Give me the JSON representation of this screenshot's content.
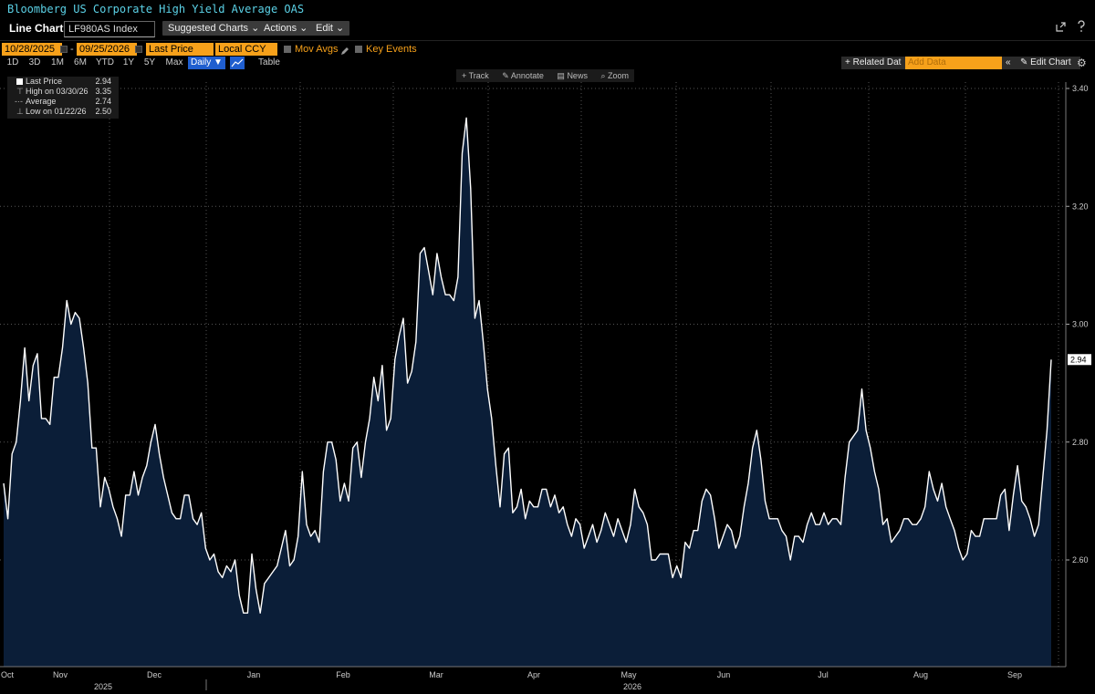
{
  "window": {
    "title": "Bloomberg US Corporate High Yield Average OAS"
  },
  "toolbar": {
    "chart_type": "Line Chart",
    "ticker": "LF980AS Index",
    "suggested_label": "Suggested Charts",
    "actions_label": "Actions",
    "edit_label": "Edit",
    "dropdown_glyph": "⌄"
  },
  "controls": {
    "start_date": "10/28/2025",
    "end_date": "09/25/2026",
    "date_sep": "-",
    "field": "Last Price",
    "currency": "Local CCY",
    "mov_avgs_label": "Mov Avgs",
    "key_events_label": "Key Events"
  },
  "ranges": [
    "1D",
    "3D",
    "1M",
    "6M",
    "YTD",
    "1Y",
    "5Y",
    "Max"
  ],
  "frequency": "Daily ▼",
  "table_label": "Table",
  "related_data_label": "+ Related Dat",
  "add_data_placeholder": "Add Data",
  "collapse_glyph": "«",
  "edit_chart_label": "Edit Chart",
  "chart_tools": [
    "Track",
    "Annotate",
    "News",
    "Zoom"
  ],
  "legend": [
    {
      "name": "Last Price",
      "value": "2.94"
    },
    {
      "name": "High on 03/30/26",
      "value": "3.35"
    },
    {
      "name": "Average",
      "value": "2.74"
    },
    {
      "name": "Low on 01/22/26",
      "value": "2.50"
    }
  ],
  "colors": {
    "accent": "#f7a11a",
    "title": "#5bd1e6",
    "line": "#ffffff",
    "fill": "#0b1e38",
    "background": "#000000"
  },
  "chart_data": {
    "type": "area",
    "title": "Bloomberg US Corporate High Yield Average OAS",
    "ylim": [
      2.4,
      3.42
    ],
    "yticks": [
      "3.40",
      "3.20",
      "3.00",
      "2.80",
      "2.60"
    ],
    "last_value_label": "2.94",
    "x_month_labels": [
      "Oct",
      "Nov",
      "Dec",
      "Jan",
      "Feb",
      "Mar",
      "Apr",
      "May",
      "Jun",
      "Jul",
      "Aug",
      "Sep"
    ],
    "x_year_labels": [
      "2025",
      "2026"
    ],
    "grid": true,
    "start_date": "2025-10-28",
    "end_date": "2026-09-25",
    "series": [
      {
        "values": [
          2.73,
          2.67,
          2.78,
          2.8,
          2.87,
          2.96,
          2.87,
          2.93,
          2.95,
          2.84,
          2.84,
          2.83,
          2.91,
          2.91,
          2.96,
          3.04,
          3.0,
          3.02,
          3.01,
          2.96,
          2.9,
          2.79,
          2.79,
          2.69,
          2.74,
          2.72,
          2.69,
          2.67,
          2.64,
          2.71,
          2.71,
          2.75,
          2.71,
          2.74,
          2.76,
          2.8,
          2.83,
          2.78,
          2.74,
          2.71,
          2.68,
          2.67,
          2.67,
          2.71,
          2.71,
          2.67,
          2.66,
          2.68,
          2.62,
          2.6,
          2.61,
          2.58,
          2.57,
          2.59,
          2.58,
          2.6,
          2.54,
          2.51,
          2.51,
          2.61,
          2.55,
          2.51,
          2.56,
          2.57,
          2.58,
          2.59,
          2.62,
          2.65,
          2.59,
          2.6,
          2.64,
          2.75,
          2.66,
          2.64,
          2.65,
          2.63,
          2.75,
          2.8,
          2.8,
          2.77,
          2.7,
          2.73,
          2.7,
          2.79,
          2.8,
          2.74,
          2.8,
          2.84,
          2.91,
          2.87,
          2.93,
          2.82,
          2.84,
          2.94,
          2.98,
          3.01,
          2.9,
          2.92,
          2.97,
          3.12,
          3.13,
          3.09,
          3.05,
          3.12,
          3.08,
          3.05,
          3.05,
          3.04,
          3.08,
          3.29,
          3.35,
          3.23,
          3.01,
          3.04,
          2.97,
          2.89,
          2.84,
          2.76,
          2.69,
          2.78,
          2.79,
          2.68,
          2.69,
          2.72,
          2.67,
          2.7,
          2.69,
          2.69,
          2.72,
          2.72,
          2.69,
          2.71,
          2.68,
          2.69,
          2.66,
          2.64,
          2.67,
          2.66,
          2.62,
          2.64,
          2.66,
          2.63,
          2.65,
          2.68,
          2.66,
          2.64,
          2.67,
          2.65,
          2.63,
          2.66,
          2.72,
          2.69,
          2.68,
          2.66,
          2.6,
          2.6,
          2.61,
          2.61,
          2.61,
          2.57,
          2.59,
          2.57,
          2.63,
          2.62,
          2.65,
          2.65,
          2.7,
          2.72,
          2.71,
          2.67,
          2.62,
          2.64,
          2.66,
          2.65,
          2.62,
          2.64,
          2.69,
          2.73,
          2.79,
          2.82,
          2.77,
          2.7,
          2.67,
          2.67,
          2.67,
          2.65,
          2.64,
          2.6,
          2.64,
          2.64,
          2.63,
          2.66,
          2.68,
          2.66,
          2.66,
          2.68,
          2.66,
          2.67,
          2.67,
          2.66,
          2.74,
          2.8,
          2.81,
          2.82,
          2.89,
          2.82,
          2.79,
          2.75,
          2.72,
          2.66,
          2.67,
          2.63,
          2.64,
          2.65,
          2.67,
          2.67,
          2.66,
          2.66,
          2.67,
          2.69,
          2.75,
          2.72,
          2.7,
          2.73,
          2.69,
          2.67,
          2.65,
          2.62,
          2.6,
          2.61,
          2.65,
          2.64,
          2.64,
          2.67,
          2.67,
          2.67,
          2.67,
          2.71,
          2.72,
          2.65,
          2.71,
          2.76,
          2.7,
          2.69,
          2.67,
          2.64,
          2.66,
          2.74,
          2.82,
          2.94
        ]
      }
    ]
  }
}
